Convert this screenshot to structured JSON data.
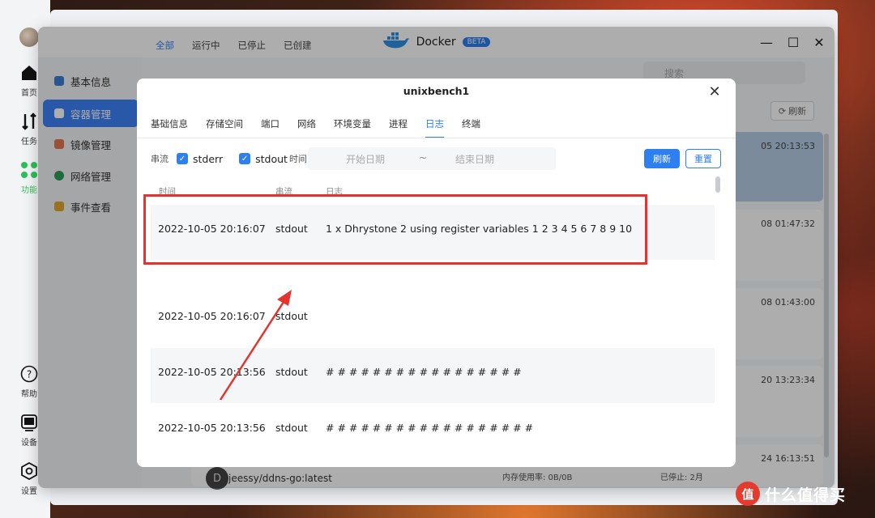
{
  "dock": {
    "items": [
      {
        "label": "首页",
        "icon": "home-icon"
      },
      {
        "label": "任务",
        "icon": "task-icon"
      },
      {
        "label": "功能",
        "icon": "apps-icon"
      },
      {
        "label": "帮助",
        "icon": "help-icon"
      },
      {
        "label": "设备",
        "icon": "device-icon"
      },
      {
        "label": "设置",
        "icon": "settings-icon"
      }
    ]
  },
  "window": {
    "app_name": "Docker",
    "badge": "BETA",
    "controls": {
      "minimize": "—",
      "maximize": "☐",
      "close": "✕"
    }
  },
  "sidebar": {
    "items": [
      {
        "label": "基本信息",
        "color": "#3d7fd6"
      },
      {
        "label": "容器管理",
        "color": "#ffffff",
        "active": true
      },
      {
        "label": "镜像管理",
        "color": "#e2764f"
      },
      {
        "label": "网络管理",
        "color": "#2f9e5a"
      },
      {
        "label": "事件查看",
        "color": "#e0a82c"
      }
    ]
  },
  "main": {
    "filter_tabs": [
      "全部",
      "运行中",
      "已停止",
      "已创建"
    ],
    "search_placeholder": "搜索",
    "refresh_label": "刷新",
    "card_times": [
      "05 20:13:53",
      "08 01:47:32",
      "08 01:43:00",
      "20 13:23:34",
      "24 16:13:51"
    ],
    "bottom_row": {
      "avatar_letter": "D",
      "image_name": "jeessy/ddns-go:latest",
      "memory": "内存使用率: 0B/0B",
      "status": "已停止: 2月"
    }
  },
  "modal": {
    "title": "unixbench1",
    "close_label": "✕",
    "tabs": [
      "基础信息",
      "存储空间",
      "端口",
      "网络",
      "环境变量",
      "进程",
      "日志",
      "终端"
    ],
    "active_tab": "日志",
    "filter": {
      "stream_label": "串流",
      "stderr_label": "stderr",
      "stdout_label": "stdout",
      "time_label": "时间",
      "start_placeholder": "开始日期",
      "separator": "~",
      "end_placeholder": "结束日期",
      "refresh_button": "刷新",
      "reset_button": "重置"
    },
    "columns": {
      "time": "时间",
      "stream": "串流",
      "message": "日志"
    },
    "rows": [
      {
        "time": "2022-10-05 20:16:07",
        "stream": "stdout",
        "message": "1 x Dhrystone 2 using register variables 1 2 3 4 5 6 7 8 9 10"
      },
      {
        "time": "2022-10-05 20:16:07",
        "stream": "stdout",
        "message": ""
      },
      {
        "time": "2022-10-05 20:13:56",
        "stream": "stdout",
        "message": "# # # # # # # # # # # # # # # # #"
      },
      {
        "time": "2022-10-05 20:13:56",
        "stream": "stdout",
        "message": "# # # # # # # # # # # # # # # # # #"
      }
    ]
  },
  "annotation_color": "#e5342f",
  "watermark": {
    "logo": "值",
    "text": "什么值得买"
  }
}
